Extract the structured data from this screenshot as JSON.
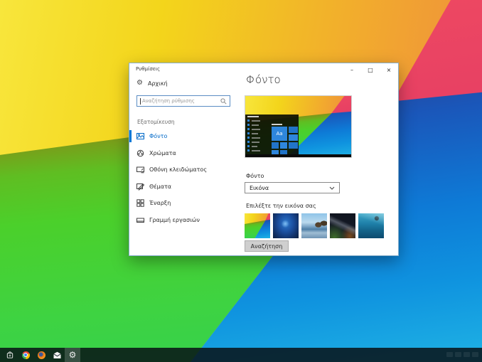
{
  "window": {
    "title": "Ρυθμίσεις",
    "controls": {
      "minimize": "–",
      "maximize": "□",
      "close": "×"
    },
    "sidebar": {
      "home_label": "Αρχική",
      "search_placeholder": "Αναζήτηση ρύθμισης",
      "section_label": "Εξατομίκευση",
      "items": [
        {
          "label": "Φόντο",
          "selected": true
        },
        {
          "label": "Χρώματα",
          "selected": false
        },
        {
          "label": "Οθόνη κλειδώματος",
          "selected": false
        },
        {
          "label": "Θέματα",
          "selected": false
        },
        {
          "label": "Έναρξη",
          "selected": false
        },
        {
          "label": "Γραμμή εργασιών",
          "selected": false
        }
      ]
    },
    "main": {
      "heading": "Φόντο",
      "preview_tile_label": "Aa",
      "background_label": "Φόντο",
      "dropdown_value": "Εικόνα",
      "choose_label": "Επιλέξτε την εικόνα σας",
      "browse_button": "Αναζήτηση",
      "thumbnails": [
        "colorful-abstract",
        "windows-hero",
        "beach-rocks",
        "night-sky",
        "underwater"
      ]
    }
  },
  "taskbar": {
    "icons": [
      "store",
      "chrome",
      "firefox",
      "mail",
      "settings"
    ],
    "active_icon": "settings"
  },
  "colors": {
    "accent": "#0078D7",
    "wallpaper_yellow": "#F3D51B",
    "wallpaper_orange": "#EF8F3C",
    "wallpaper_pink": "#E23A64",
    "wallpaper_green": "#46D336",
    "wallpaper_blue": "#0F93DF"
  }
}
